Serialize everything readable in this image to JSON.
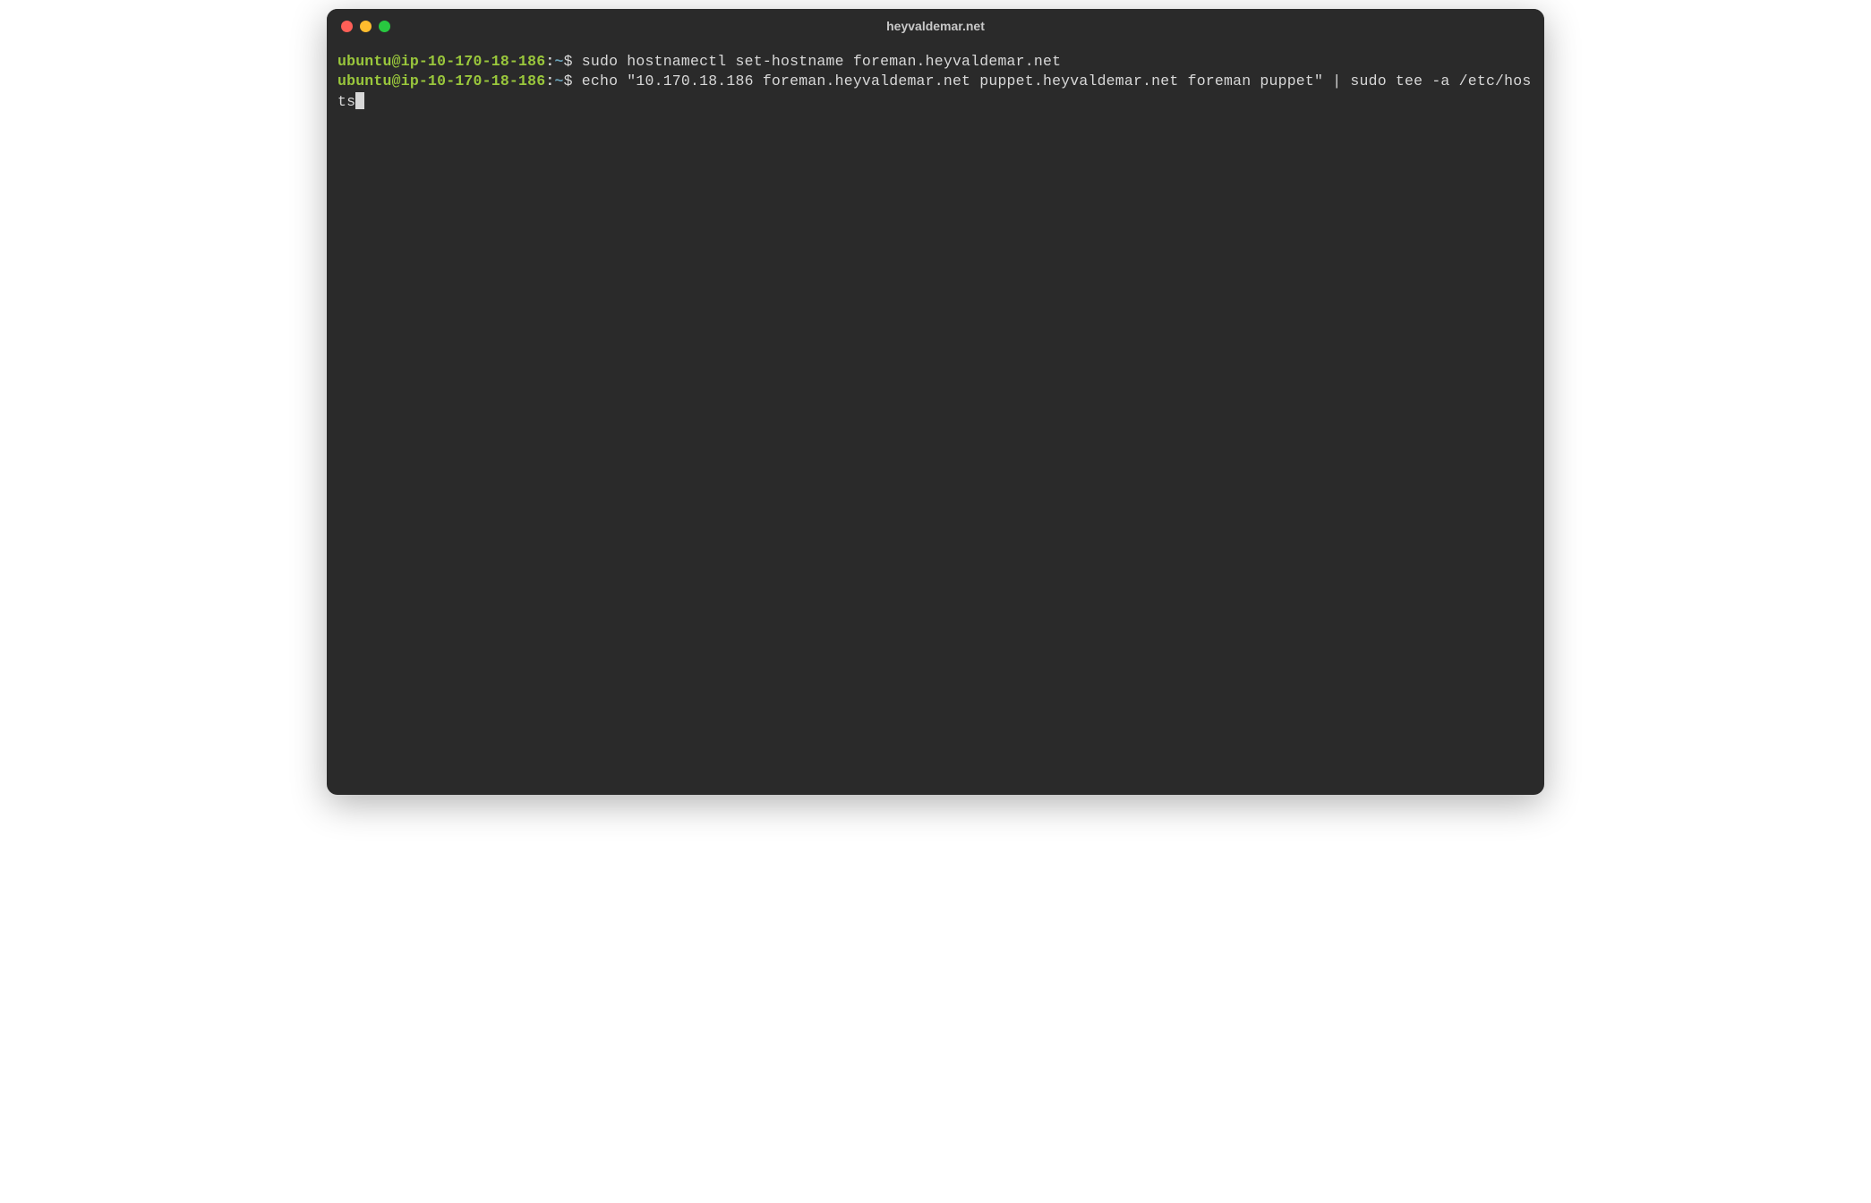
{
  "window": {
    "title": "heyvaldemar.net"
  },
  "prompt": {
    "user_host": "ubuntu@ip-10-170-18-186",
    "colon": ":",
    "path": "~",
    "symbol": "$"
  },
  "lines": [
    {
      "command": "sudo hostnamectl set-hostname foreman.heyvaldemar.net"
    },
    {
      "command": "echo \"10.170.18.186 foreman.heyvaldemar.net puppet.heyvaldemar.net foreman puppet\" | sudo tee -a /etc/hosts"
    }
  ]
}
